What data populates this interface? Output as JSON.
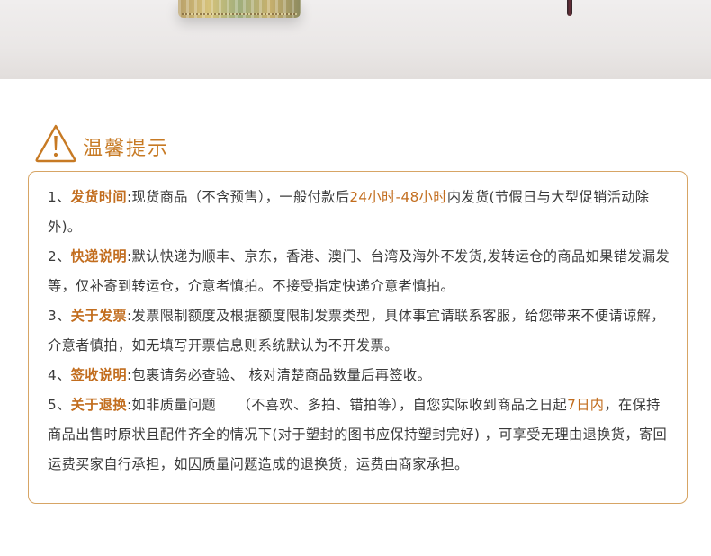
{
  "header": {
    "title": "温馨提示",
    "icon": "warning-triangle-icon",
    "accent_color": "#c77a24"
  },
  "colors": {
    "border": "#d7a565",
    "keyword": "#c26d1e",
    "text": "#3a3a3a"
  },
  "notices": [
    {
      "number": "1、",
      "key": "发货时间",
      "segments": [
        {
          "text": ":现货商品（不含预售），一般付款后",
          "highlight": false
        },
        {
          "text": "24小时-48小时",
          "highlight": true
        },
        {
          "text": "内发货(节假日与大型促销活动除外)。",
          "highlight": false
        }
      ]
    },
    {
      "number": "2、",
      "key": "快递说明",
      "segments": [
        {
          "text": ":默认快递为顺丰、京东，香港、澳门、台湾及海外不发货,发转运仓的商品如果错发漏发等，仅补寄到转运仓，介意者慎拍。不接受指定快递介意者慎拍。",
          "highlight": false
        }
      ]
    },
    {
      "number": "3、",
      "key": "关于发票",
      "segments": [
        {
          "text": ":发票限制额度及根据额度限制发票类型，具体事宜请联系客服，给您带来不便请谅解，介意者慎拍，如无填写开票信息则系统默认为不开发票。",
          "highlight": false
        }
      ]
    },
    {
      "number": "4、",
      "key": "签收说明",
      "segments": [
        {
          "text": ":包裹请务必查验、 核对清楚商品数量后再签收。",
          "highlight": false
        }
      ]
    },
    {
      "number": "5、",
      "key": "关于退换",
      "segments": [
        {
          "text": ":如非质量问题　　（不喜欢、多拍、错拍等），自您实际收到商品之日起",
          "highlight": false
        },
        {
          "text": "7日内",
          "highlight": true
        },
        {
          "text": "，在保持商品出售时原状且配件齐全的情况下(对于塑封的图书应保持塑封完好) ，可享受无理由退换货，寄回运费买家自行承担，如因质量问题造成的退换货，运费由商家承担。",
          "highlight": false
        }
      ]
    }
  ]
}
